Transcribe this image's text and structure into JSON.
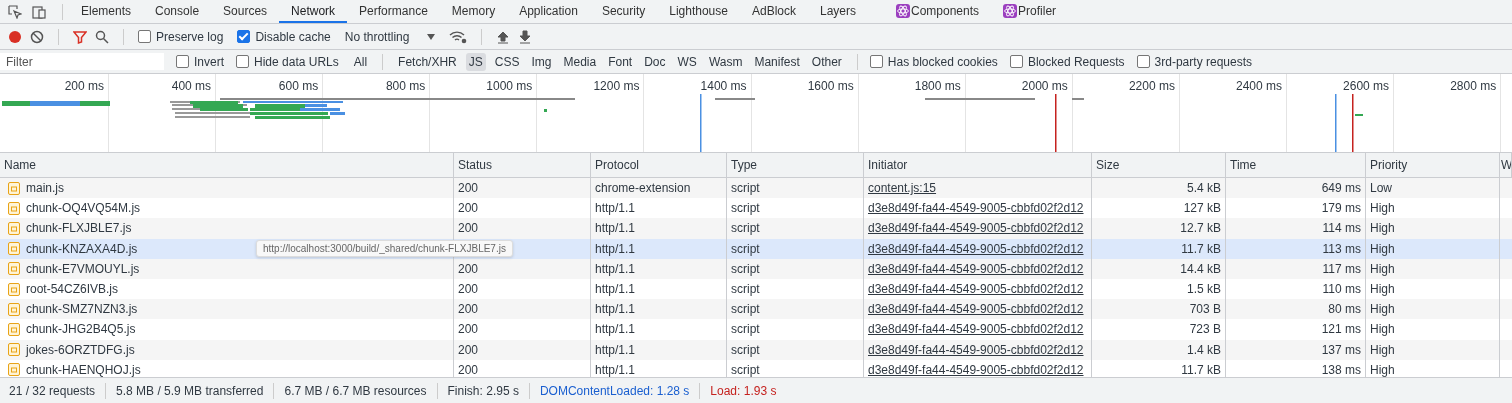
{
  "tabs": [
    {
      "label": "Elements",
      "selected": false,
      "kind": "plain"
    },
    {
      "label": "Console",
      "selected": false,
      "kind": "plain"
    },
    {
      "label": "Sources",
      "selected": false,
      "kind": "plain"
    },
    {
      "label": "Network",
      "selected": true,
      "kind": "plain"
    },
    {
      "label": "Performance",
      "selected": false,
      "kind": "plain"
    },
    {
      "label": "Memory",
      "selected": false,
      "kind": "plain"
    },
    {
      "label": "Application",
      "selected": false,
      "kind": "plain"
    },
    {
      "label": "Security",
      "selected": false,
      "kind": "plain"
    },
    {
      "label": "Lighthouse",
      "selected": false,
      "kind": "plain"
    },
    {
      "label": "AdBlock",
      "selected": false,
      "kind": "plain"
    },
    {
      "label": "Layers",
      "selected": false,
      "kind": "plain"
    },
    {
      "label": "Components",
      "selected": false,
      "kind": "react"
    },
    {
      "label": "Profiler",
      "selected": false,
      "kind": "react"
    }
  ],
  "toolbar": {
    "recording": true,
    "filter_active": true,
    "preserve_log": {
      "label": "Preserve log",
      "checked": false
    },
    "disable_cache": {
      "label": "Disable cache",
      "checked": true
    },
    "throttling": "No throttling"
  },
  "filter_bar": {
    "placeholder": "Filter",
    "invert": {
      "label": "Invert",
      "checked": false
    },
    "hide_data_urls": {
      "label": "Hide data URLs",
      "checked": false
    },
    "types": [
      {
        "label": "All",
        "selected": false
      },
      {
        "label": "Fetch/XHR",
        "selected": false
      },
      {
        "label": "JS",
        "selected": true
      },
      {
        "label": "CSS",
        "selected": false
      },
      {
        "label": "Img",
        "selected": false
      },
      {
        "label": "Media",
        "selected": false
      },
      {
        "label": "Font",
        "selected": false
      },
      {
        "label": "Doc",
        "selected": false
      },
      {
        "label": "WS",
        "selected": false
      },
      {
        "label": "Wasm",
        "selected": false
      },
      {
        "label": "Manifest",
        "selected": false
      },
      {
        "label": "Other",
        "selected": false
      }
    ],
    "options": [
      {
        "label": "Has blocked cookies",
        "checked": false
      },
      {
        "label": "Blocked Requests",
        "checked": false
      },
      {
        "label": "3rd-party requests",
        "checked": false
      }
    ]
  },
  "overview": {
    "ticks": [
      "200 ms",
      "400 ms",
      "600 ms",
      "800 ms",
      "1000 ms",
      "1200 ms",
      "1400 ms",
      "1600 ms",
      "1800 ms",
      "2000 ms",
      "2200 ms",
      "2400 ms",
      "2600 ms",
      "2800 ms"
    ]
  },
  "table": {
    "columns": [
      "Name",
      "Status",
      "Protocol",
      "Type",
      "Initiator",
      "Size",
      "Time",
      "Priority",
      "W"
    ],
    "rows": [
      {
        "name": "main.js",
        "status": "200",
        "protocol": "chrome-extension",
        "type": "script",
        "initiator": "content.js:15",
        "size": "5.4 kB",
        "time": "649 ms",
        "priority": "Low",
        "hovered": false
      },
      {
        "name": "chunk-OQ4VQ54M.js",
        "status": "200",
        "protocol": "http/1.1",
        "type": "script",
        "initiator": "d3e8d49f-fa44-4549-9005-cbbfd02f2d12",
        "size": "127 kB",
        "time": "179 ms",
        "priority": "High",
        "hovered": false
      },
      {
        "name": "chunk-FLXJBLE7.js",
        "status": "200",
        "protocol": "http/1.1",
        "type": "script",
        "initiator": "d3e8d49f-fa44-4549-9005-cbbfd02f2d12",
        "size": "12.7 kB",
        "time": "114 ms",
        "priority": "High",
        "hovered": false
      },
      {
        "name": "chunk-KNZAXA4D.js",
        "protocol": "http/1.1",
        "type": "script",
        "initiator": "d3e8d49f-fa44-4549-9005-cbbfd02f2d12",
        "size": "11.7 kB",
        "time": "113 ms",
        "priority": "High",
        "hovered": true
      },
      {
        "name": "chunk-E7VMOUYL.js",
        "status": "200",
        "protocol": "http/1.1",
        "type": "script",
        "initiator": "d3e8d49f-fa44-4549-9005-cbbfd02f2d12",
        "size": "14.4 kB",
        "time": "117 ms",
        "priority": "High",
        "hovered": false
      },
      {
        "name": "root-54CZ6IVB.js",
        "status": "200",
        "protocol": "http/1.1",
        "type": "script",
        "initiator": "d3e8d49f-fa44-4549-9005-cbbfd02f2d12",
        "size": "1.5 kB",
        "time": "110 ms",
        "priority": "High",
        "hovered": false
      },
      {
        "name": "chunk-SMZ7NZN3.js",
        "status": "200",
        "protocol": "http/1.1",
        "type": "script",
        "initiator": "d3e8d49f-fa44-4549-9005-cbbfd02f2d12",
        "size": "703 B",
        "time": "80 ms",
        "priority": "High",
        "hovered": false
      },
      {
        "name": "chunk-JHG2B4Q5.js",
        "status": "200",
        "protocol": "http/1.1",
        "type": "script",
        "initiator": "d3e8d49f-fa44-4549-9005-cbbfd02f2d12",
        "size": "723 B",
        "time": "121 ms",
        "priority": "High",
        "hovered": false
      },
      {
        "name": "jokes-6ORZTDFG.js",
        "status": "200",
        "protocol": "http/1.1",
        "type": "script",
        "initiator": "d3e8d49f-fa44-4549-9005-cbbfd02f2d12",
        "size": "1.4 kB",
        "time": "137 ms",
        "priority": "High",
        "hovered": false
      },
      {
        "name": "chunk-HAENQHOJ.js",
        "status": "200",
        "protocol": "http/1.1",
        "type": "script",
        "initiator": "d3e8d49f-fa44-4549-9005-cbbfd02f2d12",
        "size": "11.7 kB",
        "time": "138 ms",
        "priority": "High",
        "hovered": false
      }
    ]
  },
  "tooltip": "http://localhost:3000/build/_shared/chunk-FLXJBLE7.js",
  "status_bar": [
    {
      "text": "21 / 32 requests",
      "kind": "plain"
    },
    {
      "text": "5.8 MB / 5.9 MB transferred",
      "kind": "plain"
    },
    {
      "text": "6.7 MB / 6.7 MB resources",
      "kind": "plain"
    },
    {
      "text": "Finish: 2.95 s",
      "kind": "plain"
    },
    {
      "text": "DOMContentLoaded: 1.28 s",
      "kind": "dom"
    },
    {
      "text": "Load: 1.93 s",
      "kind": "load"
    }
  ]
}
